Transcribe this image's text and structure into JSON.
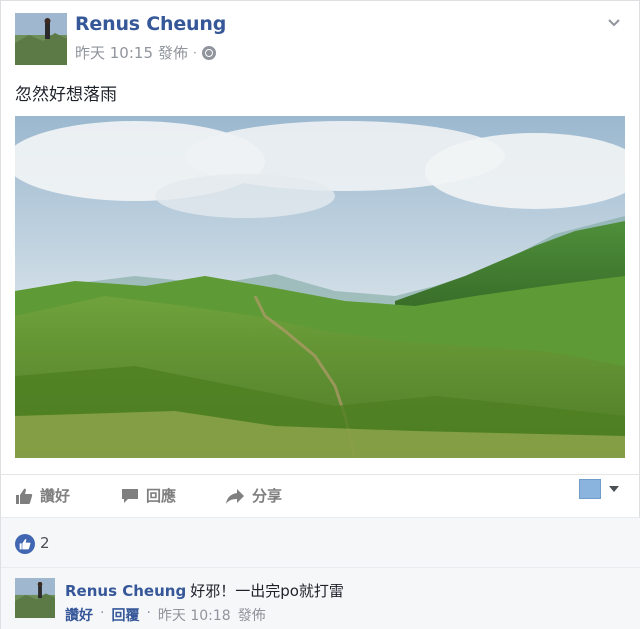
{
  "post": {
    "author": "Renus Cheung",
    "time": "昨天 10:15",
    "action": "發佈",
    "separator": "·",
    "text": "忽然好想落雨"
  },
  "actions": {
    "like": "讚好",
    "comment": "回應",
    "share": "分享"
  },
  "icons": {
    "menu": "chevron-down-icon",
    "privacy": "globe-icon",
    "like": "thumbs-up-icon",
    "comment": "speech-bubble-icon",
    "share": "share-arrow-icon",
    "audience": "audience-swatch-icon"
  },
  "colors": {
    "link": "#365899",
    "muted": "#90949c",
    "action": "#7f7f7f",
    "like_badge": "#4267b2"
  },
  "reactions": {
    "count": "2"
  },
  "comment": {
    "author": "Renus Cheung",
    "text": "好邪！一出完po就打雷",
    "like": "讚好",
    "reply": "回覆",
    "dot": "·",
    "time": "昨天 10:18",
    "action": "發佈"
  }
}
